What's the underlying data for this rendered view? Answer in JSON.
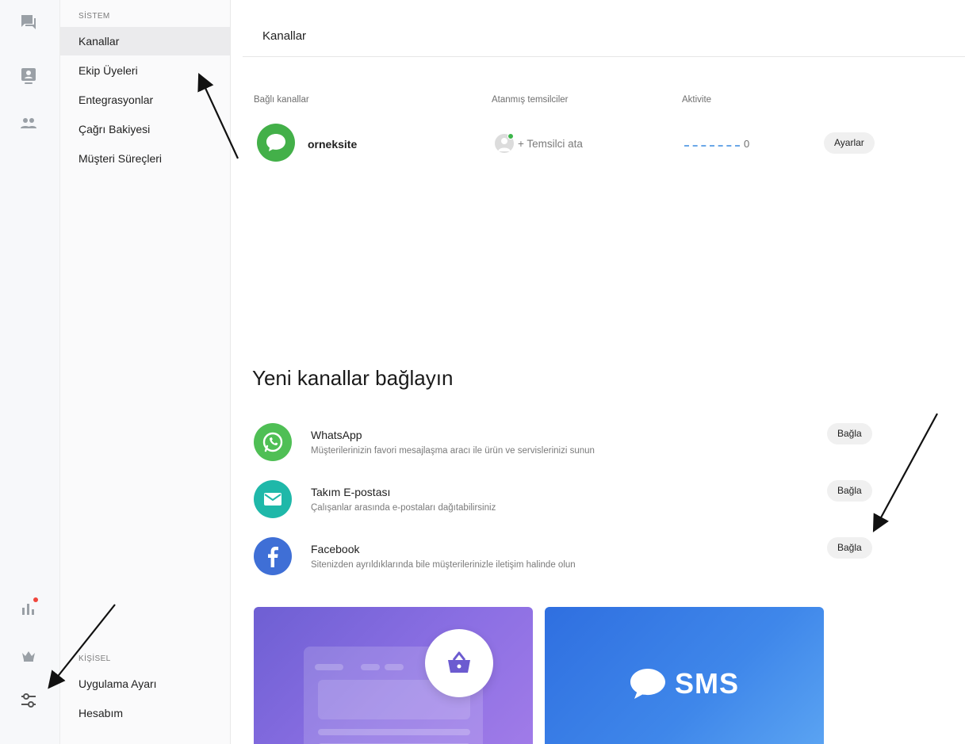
{
  "rail": {
    "icons": [
      "chat-icon",
      "contacts-card-icon",
      "team-icon",
      "analytics-icon",
      "crown-icon",
      "settings-sliders-icon"
    ]
  },
  "settings": {
    "system_label": "SİSTEM",
    "system_items": [
      "Kanallar",
      "Ekip Üyeleri",
      "Entegrasyonlar",
      "Çağrı Bakiyesi",
      "Müşteri Süreçleri"
    ],
    "personal_label": "KİŞİSEL",
    "personal_items": [
      "Uygulama Ayarı",
      "Hesabım"
    ],
    "active_item": "Kanallar"
  },
  "main": {
    "title": "Kanallar",
    "table": {
      "headers": [
        "Bağlı kanallar",
        "Atanmış temsilciler",
        "Aktivite"
      ],
      "rows": [
        {
          "channel": "orneksite",
          "assign_label": "+ Temsilci ata",
          "activity_count": "0",
          "button": "Ayarlar"
        }
      ]
    },
    "new_channels": {
      "title": "Yeni kanallar bağlayın",
      "items": [
        {
          "name": "WhatsApp",
          "desc": "Müşterilerinizin favori mesajlaşma aracı ile ürün ve servislerinizi sunun",
          "button": "Bağla",
          "color": "#4fbf55"
        },
        {
          "name": "Takım E-postası",
          "desc": "Çalışanlar arasında e-postaları dağıtabilirsiniz",
          "button": "Bağla",
          "color": "#1fb8a9"
        },
        {
          "name": "Facebook",
          "desc": "Sitenizden ayrıldıklarında bile müşterilerinizle iletişim halinde olun",
          "button": "Bağla",
          "color": "#3f6fd6"
        }
      ]
    },
    "cards": {
      "sms_label": "SMS"
    }
  }
}
